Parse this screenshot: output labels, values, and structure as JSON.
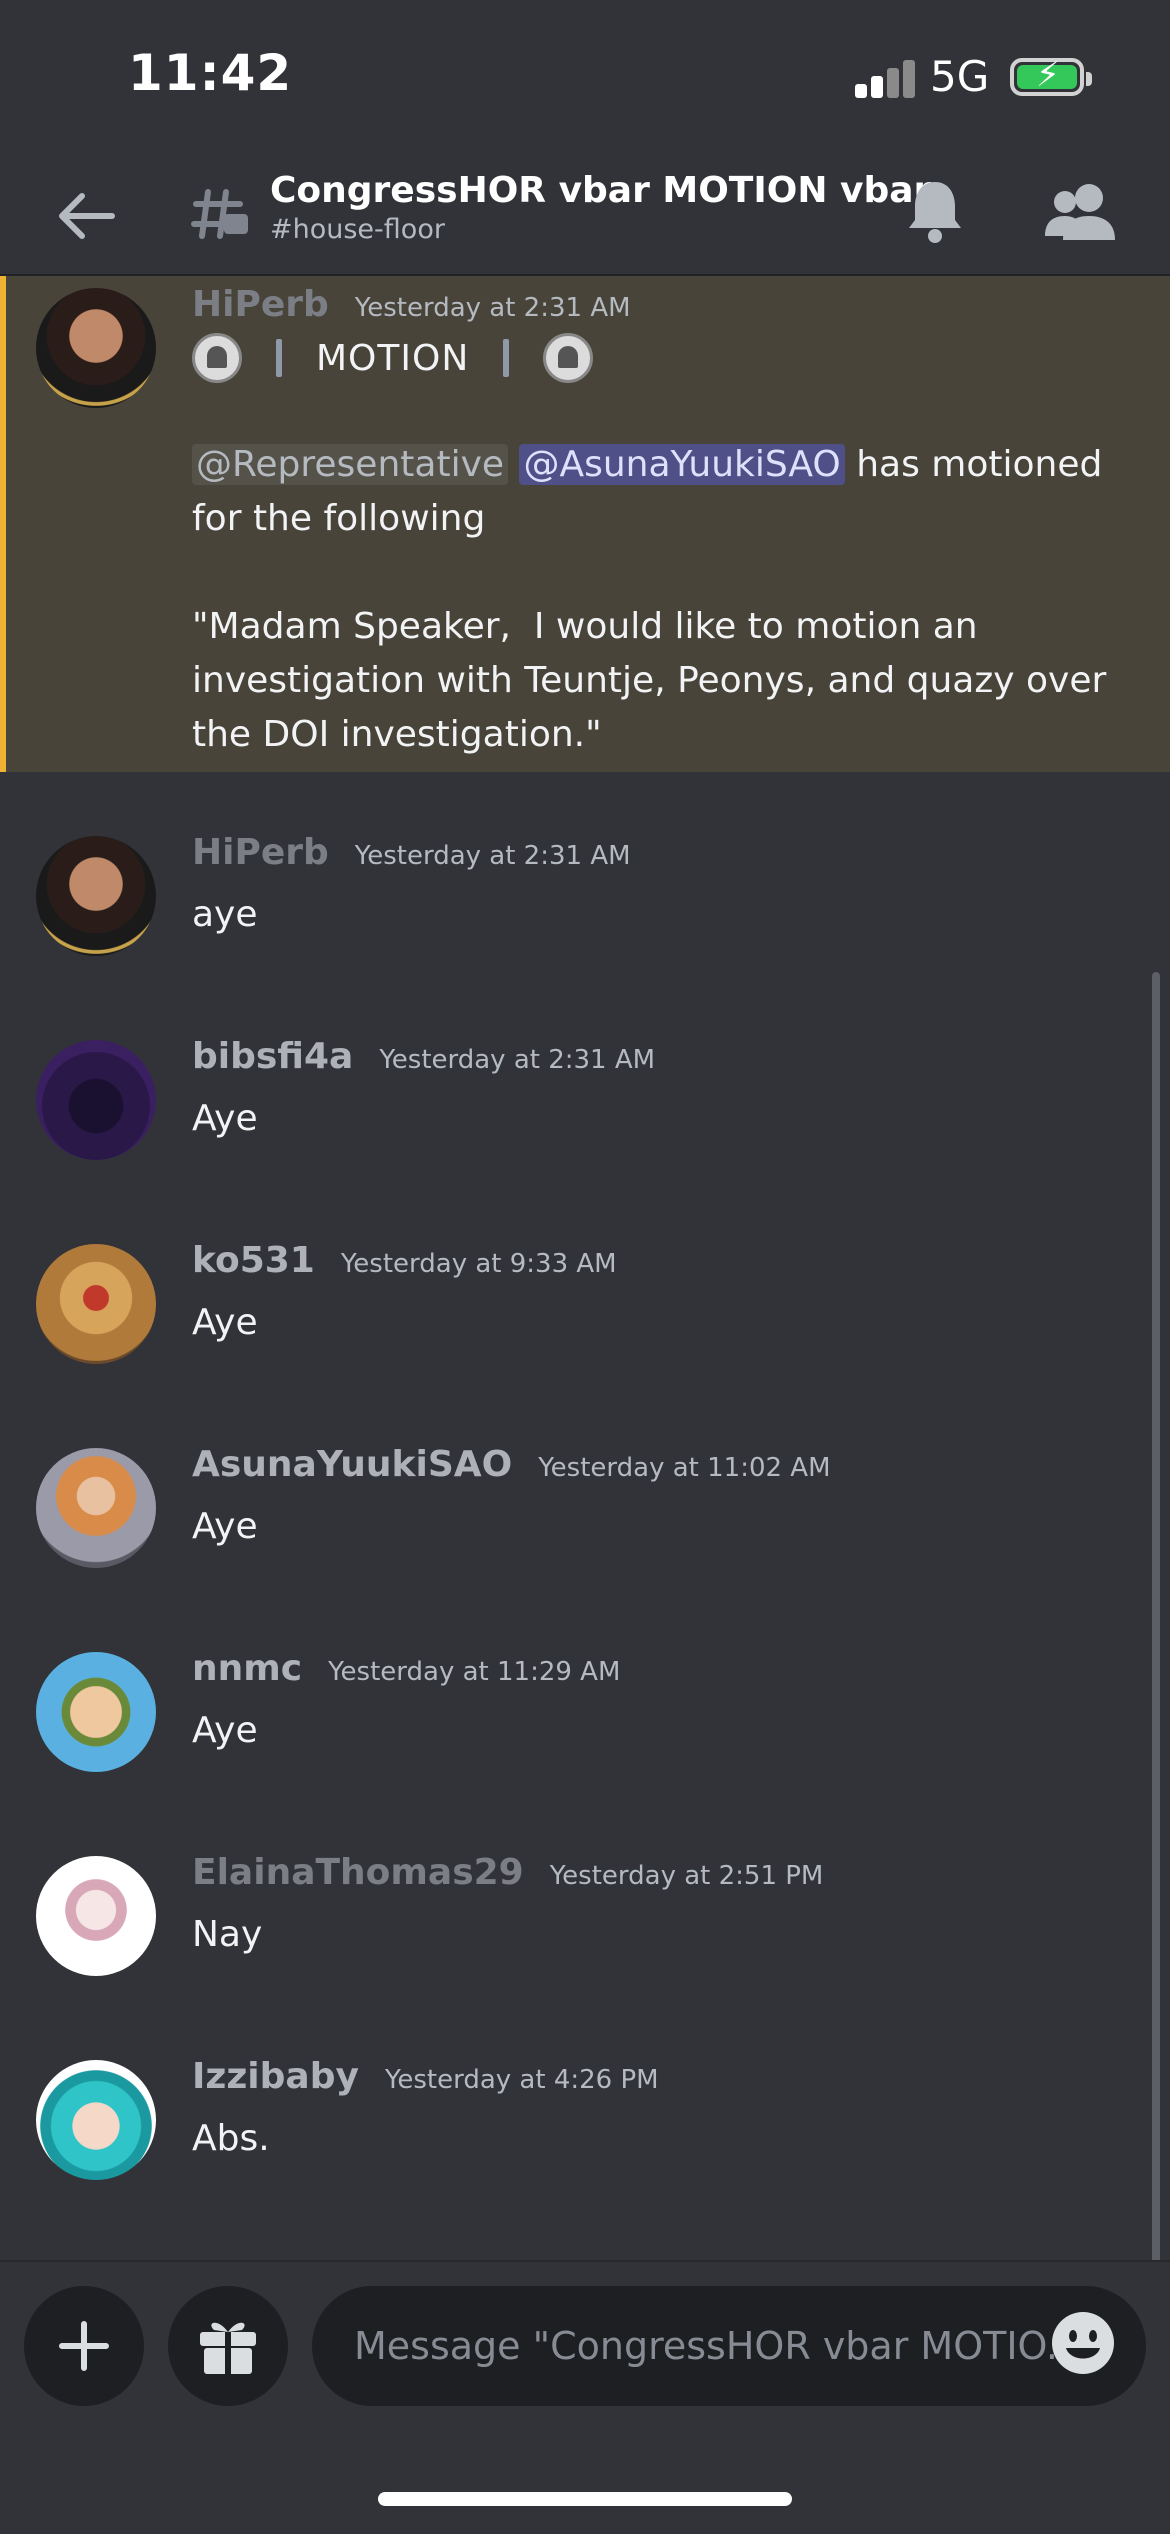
{
  "status_bar": {
    "time": "11:42",
    "network": "5G"
  },
  "header": {
    "title": "CongressHOR vbar MOTION vbar",
    "subtitle": "#house-floor"
  },
  "highlight_message": {
    "username": "HiPerb",
    "timestamp": "Yesterday at 2:31 AM",
    "motion_label": "MOTION",
    "mention_role": "@Representative",
    "mention_user": "@AsunaYuukiSAO",
    "text_after_mentions": "has motioned",
    "line2": "for the following",
    "quote_line1": "\"Madam Speaker,  I would like to motion an",
    "quote_line2": "investigation with Teuntje, Peonys, and quazy over",
    "quote_line3": "the DOI investigation.\""
  },
  "messages": [
    {
      "username": "HiPerb",
      "timestamp": "Yesterday at 2:31 AM",
      "text": "aye",
      "name_color": "#7b7e85"
    },
    {
      "username": "bibsfi4a",
      "timestamp": "Yesterday at 2:31 AM",
      "text": "Aye",
      "name_color": "#aeb1b8"
    },
    {
      "username": "ko531",
      "timestamp": "Yesterday at 9:33 AM",
      "text": "Aye",
      "name_color": "#aeb1b8"
    },
    {
      "username": "AsunaYuukiSAO",
      "timestamp": "Yesterday at 11:02 AM",
      "text": "Aye",
      "name_color": "#aeb1b8"
    },
    {
      "username": "nnmc",
      "timestamp": "Yesterday at 11:29 AM",
      "text": "Aye",
      "name_color": "#aeb1b8"
    },
    {
      "username": "ElainaThomas29",
      "timestamp": "Yesterday at 2:51 PM",
      "text": "Nay",
      "name_color": "#7b7e85"
    },
    {
      "username": "Izzibaby",
      "timestamp": "Yesterday at 4:26 PM",
      "text": "Abs.",
      "name_color": "#aeb1b8"
    }
  ],
  "composer": {
    "placeholder": "Message \"CongressHOR vbar MOTIO..."
  },
  "colors": {
    "background": "#313338",
    "highlight_bg": "#48443a",
    "highlight_border": "#f0b232",
    "mention_bg": "#4e5087",
    "battery_fill": "#34c759"
  },
  "icons": [
    "back-arrow-icon",
    "channel-hash-icon",
    "bell-icon",
    "members-icon",
    "plus-icon",
    "gift-icon",
    "emoji-icon"
  ]
}
